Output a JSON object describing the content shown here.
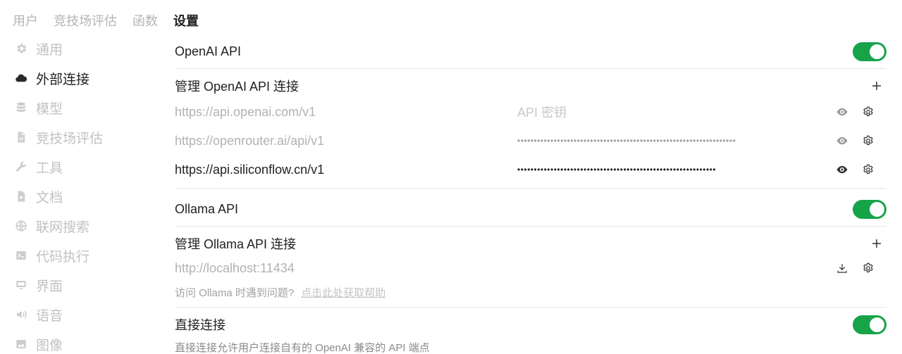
{
  "top_tabs": [
    "用户",
    "竞技场评估",
    "函数",
    "设置"
  ],
  "sidebar": {
    "items": [
      {
        "label": "通用",
        "icon": "gear-icon"
      },
      {
        "label": "外部连接",
        "icon": "cloud-icon"
      },
      {
        "label": "模型",
        "icon": "database-icon"
      },
      {
        "label": "竞技场评估",
        "icon": "document-chart-icon"
      },
      {
        "label": "工具",
        "icon": "wrench-icon"
      },
      {
        "label": "文档",
        "icon": "document-icon"
      },
      {
        "label": "联网搜索",
        "icon": "globe-icon"
      },
      {
        "label": "代码执行",
        "icon": "terminal-icon"
      },
      {
        "label": "界面",
        "icon": "monitor-icon"
      },
      {
        "label": "语音",
        "icon": "speaker-icon"
      },
      {
        "label": "图像",
        "icon": "image-icon"
      }
    ]
  },
  "openai": {
    "title": "OpenAI API",
    "enabled": true,
    "manage_title": "管理 OpenAI API 连接",
    "connections": [
      {
        "url": "https://api.openai.com/v1",
        "key": "API 密钥"
      },
      {
        "url": "https://openrouter.ai/api/v1",
        "key": "••••••••••••••••••••••••••••••••••••••••••••••••••••••••••••••••••"
      },
      {
        "url": "https://api.siliconflow.cn/v1",
        "key": "••••••••••••••••••••••••••••••••••••••••••••••••••••••••••••"
      }
    ]
  },
  "ollama": {
    "title": "Ollama API",
    "enabled": true,
    "manage_title": "管理 Ollama API 连接",
    "url": "http://localhost:11434",
    "help_text": "访问 Ollama 时遇到问题?",
    "help_link": "点击此处获取帮助"
  },
  "direct": {
    "title": "直接连接",
    "enabled": true,
    "description": "直接连接允许用户连接自有的 OpenAI 兼容的 API 端点"
  },
  "colors": {
    "toggle_on": "#16a34a"
  }
}
